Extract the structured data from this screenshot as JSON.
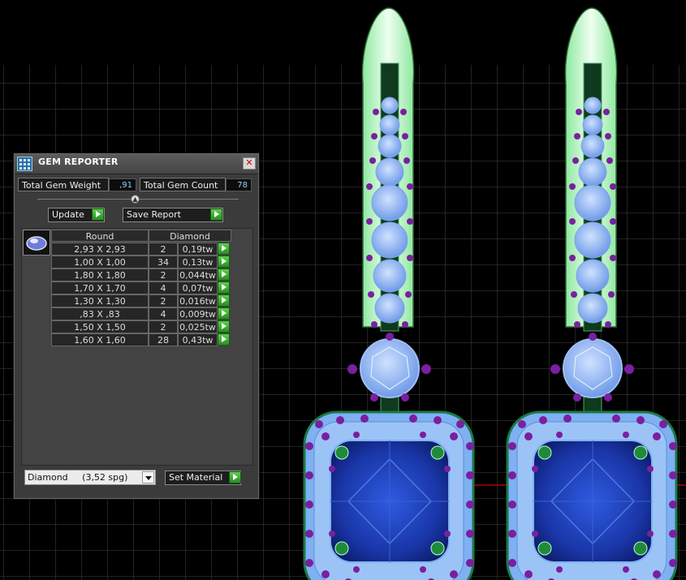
{
  "panel": {
    "title": "GEM REPORTER",
    "total_gem_weight_label": "Total Gem Weight",
    "total_gem_weight": ",91",
    "total_gem_count_label": "Total Gem Count",
    "total_gem_count": "78",
    "update_label": "Update",
    "save_report_label": "Save Report",
    "columns": {
      "shape": "Round",
      "material": "Diamond"
    },
    "rows": [
      {
        "size": "2,93 X 2,93",
        "count": "2",
        "weight": "0,19tw"
      },
      {
        "size": "1,00 X 1,00",
        "count": "34",
        "weight": "0,13tw"
      },
      {
        "size": "1,80 X 1,80",
        "count": "2",
        "weight": "0,044tw"
      },
      {
        "size": "1,70 X 1,70",
        "count": "4",
        "weight": "0,07tw"
      },
      {
        "size": "1,30 X 1,30",
        "count": "2",
        "weight": "0,016tw"
      },
      {
        "size": ",83 X ,83",
        "count": "4",
        "weight": "0,009tw"
      },
      {
        "size": "1,50 X 1,50",
        "count": "2",
        "weight": "0,025tw"
      },
      {
        "size": "1,60 X 1,60",
        "count": "28",
        "weight": "0,43tw"
      }
    ],
    "material_select": "Diamond     (3,52 spg)",
    "set_material_label": "Set Material",
    "close_glyph": "✕",
    "icons": [
      "gem-reporter-app-icon",
      "close-icon",
      "go-arrow-icon",
      "round-gem-thumbnail",
      "dropdown-arrow-icon"
    ]
  },
  "colors": {
    "background": "#000000",
    "grid": "#3a3a3a",
    "center_stone": "#1e3fb0",
    "accent_stones": "#8fb7f5",
    "prongs": "#7a1fa0",
    "ear_wire": "#c9ffd0",
    "green_prongs": "#1f8a3a",
    "axis_red": "#d40000"
  }
}
